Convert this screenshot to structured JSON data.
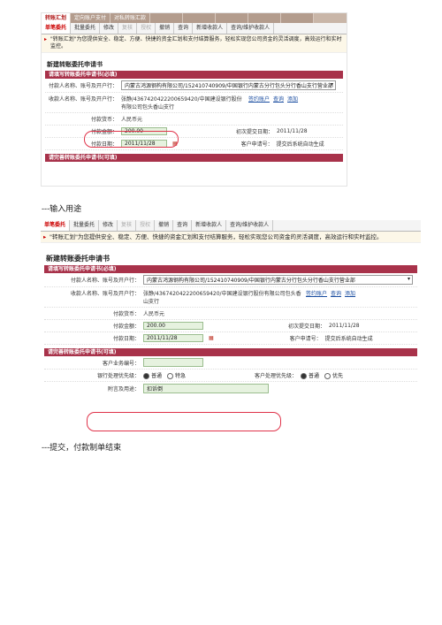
{
  "screenshot1": {
    "top_tabs": [
      "转账汇划",
      "定向账户支付",
      "对私转账汇款",
      "",
      "",
      "",
      "",
      "",
      ""
    ],
    "sub_tabs": [
      "单笔委托",
      "批量委托",
      "修改",
      "复核",
      "授权",
      "撤销",
      "查询",
      "新增收款人",
      "查询/维护收款人"
    ],
    "notice": "\"转账汇划\"为您提供安全、稳定、方便、快捷的资金汇划和支付结算服务，轻松实现您公司资金的灵活调度，高效运行和实时监控。",
    "form_title": "新建转账委托申请书",
    "section1": "请填写转账委托申请书(必填)",
    "payer_label": "付款人名称、账号及开户行：",
    "payer_value": "内蒙古鸿源钢构有限公司/152410740909/中国银行内蒙古分行包头分行香山支行营业部",
    "payee_label": "收款人名称、账号及开户行：",
    "payee_value": "张静/4367420422200659420/中国建设银行股份有限公司包头香山支行",
    "link_sign": "签约账户",
    "link_query": "查询",
    "link_add": "添加",
    "currency_label": "付款货币：",
    "currency_value": "人民币元",
    "amount_label": "付款金额：",
    "amount_value": "200.00",
    "first_submit_label": "初次提交日期：",
    "first_submit_value": "2011/11/28",
    "pay_date_label": "付款日期：",
    "pay_date_value": "2011/11/28",
    "customer_no_label": "客户申请号：",
    "customer_no_value": "提交后系统自动生成",
    "section2": "请完善转账委托申请书(可填)"
  },
  "caption1": "---输入用途",
  "screenshot2": {
    "sub_tabs": [
      "单笔委托",
      "批量委托",
      "修改",
      "复核",
      "授权",
      "撤销",
      "查询",
      "新增收款人",
      "查询/维护收款人"
    ],
    "notice": "\"转账汇划\"为您提供安全、稳定、方便、快捷的资金汇划和支付结算服务，轻松实现您公司资金的灵活调度，高效运行和实时监控。",
    "form_title": "新建转账委托申请书",
    "section1": "请填写转账委托申请书(必填)",
    "payer_label": "付款人名称、账号及开户行：",
    "payer_value": "内蒙古鸿源钢构有限公司/152410740909/中国银行内蒙古分行包头分行香山支行营业部",
    "payee_label": "收款人名称、账号及开户行：",
    "payee_value": "张静/4367420422200659420/中国建设银行股份有限公司包头香山支行",
    "link_sign": "签约账户",
    "link_query": "查询",
    "link_add": "添加",
    "currency_label": "付款货币：",
    "currency_value": "人民币元",
    "amount_label": "付款金额：",
    "amount_value": "200.00",
    "first_submit_label": "初次提交日期：",
    "first_submit_value": "2011/11/28",
    "pay_date_label": "付款日期：",
    "pay_date_value": "2011/11/28",
    "customer_no_label": "客户申请号：",
    "customer_no_value": "提交后系统自动生成",
    "section2": "请完善转账委托申请书(可填)",
    "biz_no_label": "客户业务编号：",
    "bank_priority_label": "银行处理优先级：",
    "bank_priority_options": [
      "普通",
      "特急"
    ],
    "cust_priority_label": "客户处理优先级：",
    "cust_priority_options": [
      "普通",
      "优先"
    ],
    "memo_label": "附言及用途：",
    "memo_value": "扣诉倒"
  },
  "caption2": "---提交，付款制单结束"
}
